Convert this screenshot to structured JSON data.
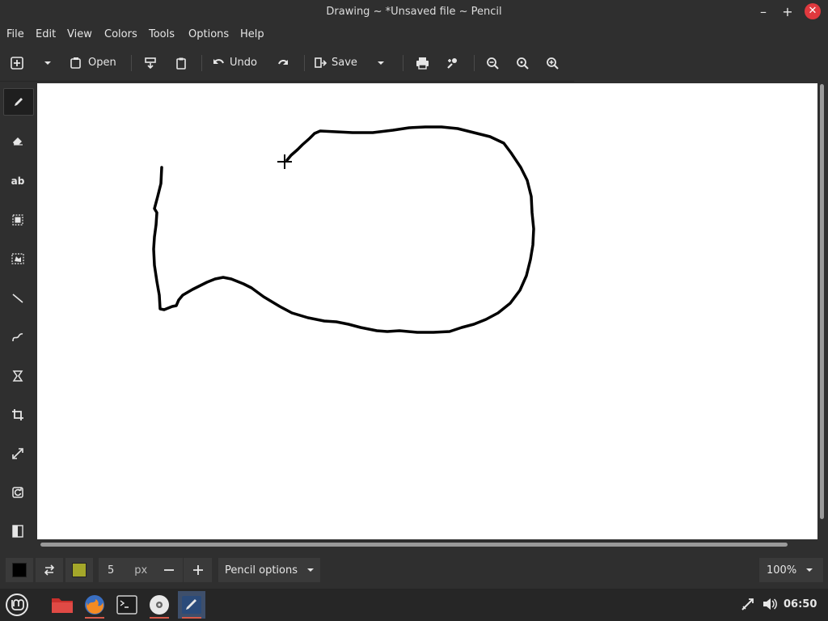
{
  "window": {
    "title": "Drawing ~ *Unsaved file ~ Pencil"
  },
  "menu": {
    "items": [
      "File",
      "Edit",
      "View",
      "Colors",
      "Tools",
      "Options",
      "Help"
    ]
  },
  "toolbar": {
    "open_label": "Open",
    "undo_label": "Undo",
    "save_label": "Save"
  },
  "tools": [
    "pencil",
    "eraser",
    "text",
    "rectangle-select",
    "free-select",
    "line",
    "curve",
    "shape",
    "crop",
    "scale",
    "rotate",
    "filters"
  ],
  "options": {
    "size_value": "5",
    "size_unit": "px",
    "tool_options_label": "Pencil options",
    "zoom_label": "100%",
    "main_color": "#000000",
    "secondary_color": "#a4a72a"
  },
  "taskbar": {
    "clock": "06:50"
  }
}
